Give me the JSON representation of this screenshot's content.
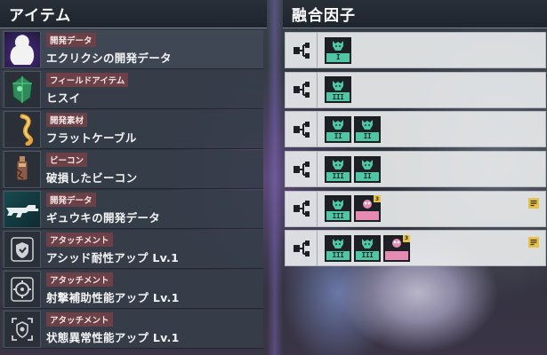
{
  "left_panel": {
    "title": "アイテム",
    "items": [
      {
        "category": "開発データ",
        "name": "エクリクシの開発データ",
        "icon": "ghost-silhouette-icon",
        "selected": true
      },
      {
        "category": "フィールドアイテム",
        "name": "ヒスイ",
        "icon": "jade-ore-icon"
      },
      {
        "category": "開発素材",
        "name": "フラットケーブル",
        "icon": "flat-cable-icon"
      },
      {
        "category": "ビーコン",
        "name": "破損したビーコン",
        "icon": "broken-beacon-icon"
      },
      {
        "category": "開発データ",
        "name": "ギュウキの開発データ",
        "icon": "rifle-icon"
      },
      {
        "category": "アタッチメント",
        "name": "アシッド耐性アップ Lv.1",
        "icon": "shield-attachment-icon"
      },
      {
        "category": "アタッチメント",
        "name": "射撃補助性能アップ Lv.1",
        "icon": "target-attachment-icon"
      },
      {
        "category": "アタッチメント",
        "name": "状態異常性能アップ Lv.1",
        "icon": "status-attachment-icon"
      }
    ]
  },
  "right_panel": {
    "title": "融合因子",
    "factors": [
      {
        "chips": [
          {
            "color": "teal",
            "label": "I"
          }
        ],
        "note": false
      },
      {
        "chips": [
          {
            "color": "teal",
            "label": "III"
          }
        ],
        "note": false
      },
      {
        "chips": [
          {
            "color": "teal",
            "label": "II"
          },
          {
            "color": "teal",
            "label": "II"
          }
        ],
        "note": false
      },
      {
        "chips": [
          {
            "color": "teal",
            "label": "III"
          },
          {
            "color": "teal",
            "label": "II"
          }
        ],
        "note": false
      },
      {
        "chips": [
          {
            "color": "teal",
            "label": "III"
          },
          {
            "color": "pink",
            "label": "",
            "badge": "3"
          }
        ],
        "note": true
      },
      {
        "chips": [
          {
            "color": "teal",
            "label": "III"
          },
          {
            "color": "teal",
            "label": "III"
          },
          {
            "color": "pink",
            "label": "",
            "badge": "3"
          }
        ],
        "note": true
      }
    ]
  },
  "colors": {
    "category_badge": "#6b4047",
    "teal_chip": "#4fc7a6",
    "pink_chip": "#e48ab3",
    "note_icon": "#e6c24a"
  }
}
